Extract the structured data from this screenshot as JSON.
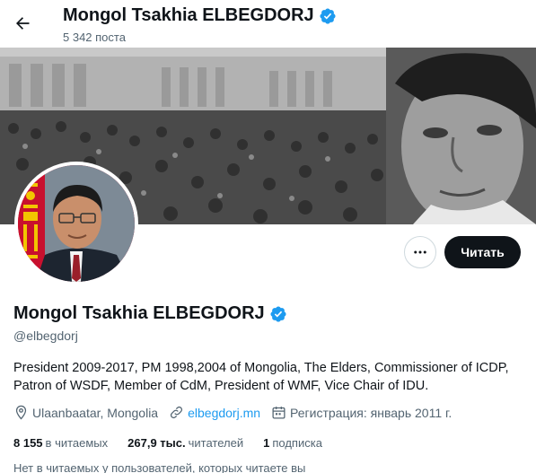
{
  "header": {
    "name": "Mongol Tsakhia ELBEGDORJ",
    "post_count": "5 342 поста"
  },
  "actions": {
    "follow_label": "Читать"
  },
  "profile": {
    "name": "Mongol Tsakhia ELBEGDORJ",
    "handle": "@elbegdorj",
    "bio": "President 2009-2017, PM 1998,2004 of Mongolia, The Elders, Commissioner of ICDP, Patron of WSDF, Member of CdM, President of WMF, Vice Chair of IDU.",
    "location": "Ulaanbaatar, Mongolia",
    "website": "elbegdorj.mn",
    "joined": "Регистрация: январь 2011 г."
  },
  "stats": {
    "mutual_count": "8 155",
    "mutual_label": "в читаемых",
    "followers_count": "267,9 тыс.",
    "followers_label": "читателей",
    "following_count": "1",
    "following_label": "подписка"
  },
  "footnote": "Нет в читаемых у пользователей, которых читаете вы",
  "colors": {
    "verified": "#1d9bf0",
    "link": "#1d9bf0",
    "text_primary": "#0f1419",
    "text_secondary": "#536471",
    "follow_button_bg": "#0f1419"
  }
}
